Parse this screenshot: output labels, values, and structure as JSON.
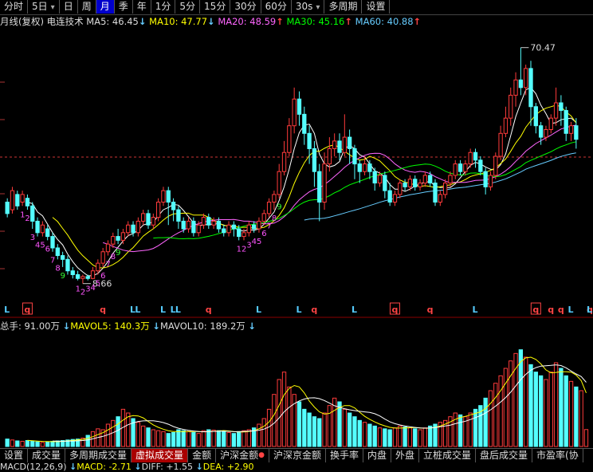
{
  "toolbar": {
    "items": [
      {
        "label": "分时"
      },
      {
        "label": "5日",
        "caret": "▾"
      },
      {
        "label": "日"
      },
      {
        "label": "周"
      },
      {
        "label": "月",
        "active": true
      },
      {
        "label": "季"
      },
      {
        "label": "年"
      },
      {
        "label": "1分"
      },
      {
        "label": "5分"
      },
      {
        "label": "15分"
      },
      {
        "label": "30分"
      },
      {
        "label": "60分"
      },
      {
        "label": "30s",
        "caret": "▾"
      },
      {
        "label": "多周期"
      },
      {
        "label": "设置"
      }
    ]
  },
  "ma_legend": {
    "period": "月线(复权)",
    "stock": "电连技术",
    "ma5": "MA5: 46.45",
    "ma10": "MA10: 47.77",
    "ma20": "MA20: 48.59",
    "ma30": "MA30: 45.16",
    "ma60": "MA60: 40.88",
    "arrow_down": "↓",
    "arrow_up": "↑"
  },
  "vol_legend": {
    "total": "总手: 91.00万",
    "mavol5": "MAVOL5: 140.3万",
    "mavol10": "MAVOL10: 189.2万",
    "arrow_down": "↓"
  },
  "macd_legend": {
    "macd": "MACD(12,26,9)",
    "macd_val": "MACD: -2.71",
    "diff": "DIFF: +1.55",
    "dea": "DEA: +2.90",
    "arrow_down": "↓"
  },
  "tabs": {
    "items": [
      {
        "label": "设置"
      },
      {
        "label": "成交量"
      },
      {
        "label": "多周期成交量"
      },
      {
        "label": "虚拟成交量",
        "active": true
      },
      {
        "label": "金额"
      },
      {
        "label": "沪深金额",
        "dot": "●"
      },
      {
        "label": "沪深京金额"
      },
      {
        "label": "换手率"
      },
      {
        "label": "内盘"
      },
      {
        "label": "外盘"
      },
      {
        "label": "立桩成交量"
      },
      {
        "label": "盘后成交量"
      },
      {
        "label": "市盈率(协"
      }
    ]
  },
  "chart_data": [
    {
      "type": "candlestick",
      "y_range": [
        4,
        75
      ],
      "annotations": {
        "high": "70.47",
        "low": "8.66"
      },
      "signal_labels": [
        "L",
        "q",
        "q",
        "L",
        "L",
        "L",
        "L",
        "L",
        "q",
        "L",
        "L",
        "q",
        "L",
        "q",
        "q",
        "L",
        "q",
        "q",
        "q",
        "L",
        "q",
        "L",
        "L"
      ],
      "sequence_labels": [
        "1",
        "2",
        "3",
        "4",
        "5",
        "6",
        "7",
        "8",
        "9",
        "1",
        "2",
        "3",
        "4",
        "5",
        "6",
        "7",
        "8",
        "9",
        "1",
        "2",
        "3",
        "4",
        "5",
        "6",
        "7",
        "8",
        "9"
      ],
      "candles": [
        [
          30,
          27,
          31,
          26
        ],
        [
          28,
          33,
          34,
          27
        ],
        [
          32,
          29,
          33,
          28
        ],
        [
          30,
          32,
          33,
          29
        ],
        [
          31,
          29,
          32,
          28
        ],
        [
          29,
          25,
          30,
          23
        ],
        [
          25,
          22,
          26,
          21
        ],
        [
          22,
          24,
          25,
          21
        ],
        [
          23,
          21,
          24,
          20
        ],
        [
          21,
          18,
          22,
          17
        ],
        [
          18,
          16,
          19,
          15
        ],
        [
          16,
          15,
          17,
          13
        ],
        [
          15,
          12,
          16,
          11
        ],
        [
          12,
          11,
          13,
          10
        ],
        [
          11,
          10,
          12,
          9.5
        ],
        [
          10,
          10.5,
          11,
          8.66
        ],
        [
          10.5,
          10,
          11,
          9.5
        ],
        [
          10,
          12,
          13,
          9.8
        ],
        [
          12,
          14,
          15,
          11
        ],
        [
          14,
          17,
          18,
          13
        ],
        [
          17,
          19,
          20,
          16
        ],
        [
          19,
          21,
          22,
          18
        ],
        [
          21,
          20,
          23,
          19
        ],
        [
          20,
          22,
          23,
          19
        ],
        [
          22,
          24,
          25,
          21
        ],
        [
          24,
          22,
          25,
          21
        ],
        [
          22,
          25,
          26,
          21
        ],
        [
          25,
          27,
          28,
          24
        ],
        [
          27,
          24,
          28,
          23
        ],
        [
          24,
          26,
          27,
          23
        ],
        [
          26,
          30,
          31,
          25
        ],
        [
          30,
          33,
          34,
          29
        ],
        [
          33,
          30,
          34,
          24
        ],
        [
          30,
          28,
          31,
          25
        ],
        [
          28,
          25,
          29,
          23
        ],
        [
          25,
          23,
          26,
          22
        ],
        [
          23,
          25,
          26,
          22
        ],
        [
          25,
          22,
          26,
          21
        ],
        [
          22,
          24,
          25,
          21
        ],
        [
          24,
          26,
          27,
          23
        ],
        [
          26,
          24,
          27,
          23
        ],
        [
          24,
          25,
          26,
          23
        ],
        [
          25,
          23,
          26,
          22
        ],
        [
          23,
          22,
          24,
          21
        ],
        [
          22,
          24,
          25,
          21
        ],
        [
          24,
          23,
          25,
          21
        ],
        [
          23,
          21,
          24,
          20
        ],
        [
          21,
          22,
          23,
          20
        ],
        [
          22,
          24,
          25,
          21
        ],
        [
          24,
          23,
          25,
          22
        ],
        [
          23,
          25,
          26,
          22
        ],
        [
          25,
          27,
          28,
          24
        ],
        [
          27,
          30,
          31,
          26
        ],
        [
          30,
          32,
          33,
          28
        ],
        [
          32,
          38,
          40,
          31
        ],
        [
          38,
          43,
          46,
          37
        ],
        [
          43,
          50,
          52,
          42
        ],
        [
          50,
          57,
          60,
          48
        ],
        [
          57,
          53,
          59,
          50
        ],
        [
          53,
          48,
          55,
          45
        ],
        [
          48,
          44,
          50,
          40
        ],
        [
          44,
          38,
          46,
          34
        ],
        [
          38,
          30,
          40,
          25
        ],
        [
          30,
          40,
          43,
          28
        ],
        [
          40,
          44,
          47,
          38
        ],
        [
          44,
          46,
          48,
          42
        ],
        [
          46,
          43,
          48,
          41
        ],
        [
          43,
          47,
          53,
          42
        ],
        [
          47,
          44,
          49,
          40
        ],
        [
          44,
          40,
          45,
          36
        ],
        [
          40,
          38,
          41,
          35
        ],
        [
          38,
          40,
          42,
          37
        ],
        [
          40,
          38,
          41,
          36
        ],
        [
          38,
          35,
          39,
          33
        ],
        [
          35,
          37,
          38,
          34
        ],
        [
          37,
          33,
          38,
          31
        ],
        [
          33,
          30,
          35,
          29
        ],
        [
          30,
          32,
          33,
          29
        ],
        [
          32,
          35,
          36,
          31
        ],
        [
          35,
          34,
          36,
          33
        ],
        [
          34,
          36,
          37,
          33
        ],
        [
          36,
          34,
          37,
          33
        ],
        [
          34,
          35,
          36,
          33
        ],
        [
          35,
          37,
          38,
          34
        ],
        [
          37,
          35,
          38,
          34
        ],
        [
          35,
          30,
          36,
          29
        ],
        [
          30,
          32,
          33,
          29
        ],
        [
          32,
          35,
          36,
          31
        ],
        [
          35,
          37,
          38,
          34
        ],
        [
          37,
          40,
          41,
          36
        ],
        [
          40,
          38,
          41,
          37
        ],
        [
          38,
          40,
          41,
          37
        ],
        [
          40,
          43,
          44,
          39
        ],
        [
          43,
          41,
          44,
          39
        ],
        [
          41,
          38,
          42,
          37
        ],
        [
          38,
          34,
          39,
          32
        ],
        [
          34,
          37,
          38,
          33
        ],
        [
          37,
          42,
          43,
          36
        ],
        [
          42,
          48,
          50,
          41
        ],
        [
          48,
          52,
          55,
          47
        ],
        [
          52,
          58,
          60,
          50
        ],
        [
          58,
          62,
          64,
          55
        ],
        [
          62,
          60,
          70.47,
          58
        ],
        [
          60,
          65,
          66,
          58
        ],
        [
          65,
          55,
          67,
          50
        ],
        [
          55,
          50,
          56,
          48
        ],
        [
          50,
          47,
          51,
          45
        ],
        [
          47,
          49,
          50,
          46
        ],
        [
          49,
          52,
          53,
          48
        ],
        [
          52,
          56,
          60,
          50
        ],
        [
          56,
          54,
          58,
          50
        ],
        [
          54,
          48,
          55,
          46
        ],
        [
          48,
          50,
          51,
          46
        ],
        [
          50,
          46.45,
          52,
          44
        ]
      ]
    },
    {
      "type": "bar",
      "y_range": [
        0,
        600
      ],
      "volumes": [
        40,
        35,
        30,
        28,
        32,
        30,
        25,
        22,
        25,
        28,
        30,
        32,
        35,
        38,
        40,
        45,
        60,
        80,
        95,
        90,
        120,
        140,
        160,
        200,
        180,
        150,
        130,
        110,
        100,
        90,
        85,
        80,
        70,
        75,
        90,
        85,
        80,
        75,
        70,
        85,
        90,
        88,
        85,
        80,
        75,
        70,
        80,
        85,
        90,
        100,
        120,
        150,
        200,
        280,
        360,
        400,
        320,
        280,
        240,
        200,
        180,
        160,
        150,
        180,
        220,
        260,
        240,
        200,
        180,
        160,
        140,
        130,
        120,
        110,
        100,
        95,
        90,
        100,
        110,
        105,
        100,
        95,
        90,
        100,
        110,
        120,
        130,
        140,
        160,
        180,
        170,
        160,
        180,
        200,
        220,
        260,
        300,
        340,
        380,
        420,
        460,
        500,
        520,
        480,
        440,
        400,
        380,
        360,
        400,
        450,
        420,
        380,
        350,
        320,
        300,
        91
      ]
    }
  ]
}
